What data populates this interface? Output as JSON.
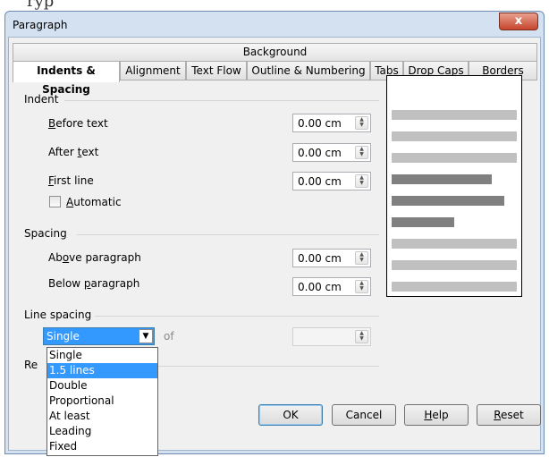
{
  "window": {
    "title": "Paragraph",
    "close_label": "x"
  },
  "top_fragment": "ryp",
  "tabs": {
    "row1": [
      "Background"
    ],
    "row2": [
      "Indents & Spacing",
      "Alignment",
      "Text Flow",
      "Outline & Numbering",
      "Tabs",
      "Drop Caps",
      "Borders"
    ],
    "active": "Indents & Spacing"
  },
  "indent": {
    "section_label": "Indent",
    "before_text": {
      "prefix": "",
      "u": "B",
      "rest": "efore text",
      "value": "0.00 cm"
    },
    "after_text": {
      "prefix": "After ",
      "u": "t",
      "rest": "ext",
      "value": "0.00 cm"
    },
    "first_line": {
      "prefix": "",
      "u": "F",
      "rest": "irst line",
      "value": "0.00 cm"
    },
    "automatic": {
      "prefix": "",
      "u": "A",
      "rest": "utomatic",
      "checked": false
    }
  },
  "spacing": {
    "section_label": "Spacing",
    "above": {
      "prefix": "Ab",
      "u": "o",
      "rest": "ve paragraph",
      "value": "0.00 cm"
    },
    "below": {
      "prefix": "Below ",
      "u": "p",
      "rest": "aragraph",
      "value": "0.00 cm"
    }
  },
  "line_spacing": {
    "section_label": "Line spacing",
    "selected": "Single",
    "of_label": "of",
    "of_value": "",
    "options": [
      "Single",
      "1.5 lines",
      "Double",
      "Proportional",
      "At least",
      "Leading",
      "Fixed"
    ],
    "highlighted": "1.5 lines"
  },
  "register_truncated": "Re",
  "buttons": {
    "ok": "OK",
    "cancel": "Cancel",
    "help": {
      "u": "H",
      "rest": "elp"
    },
    "reset": {
      "u": "R",
      "rest": "eset"
    }
  },
  "preview": {
    "lines": [
      {
        "shade": "#c0c0c0",
        "fraction": 1.0
      },
      {
        "shade": "#c0c0c0",
        "fraction": 1.0
      },
      {
        "shade": "#c0c0c0",
        "fraction": 1.0
      },
      {
        "shade": "#808080",
        "fraction": 0.8
      },
      {
        "shade": "#808080",
        "fraction": 0.9
      },
      {
        "shade": "#808080",
        "fraction": 0.5
      },
      {
        "shade": "#c0c0c0",
        "fraction": 1.0
      },
      {
        "shade": "#c0c0c0",
        "fraction": 1.0
      },
      {
        "shade": "#c0c0c0",
        "fraction": 1.0
      }
    ]
  },
  "colors": {
    "selection": "#3399ff",
    "frame": "#d3e1f1"
  }
}
